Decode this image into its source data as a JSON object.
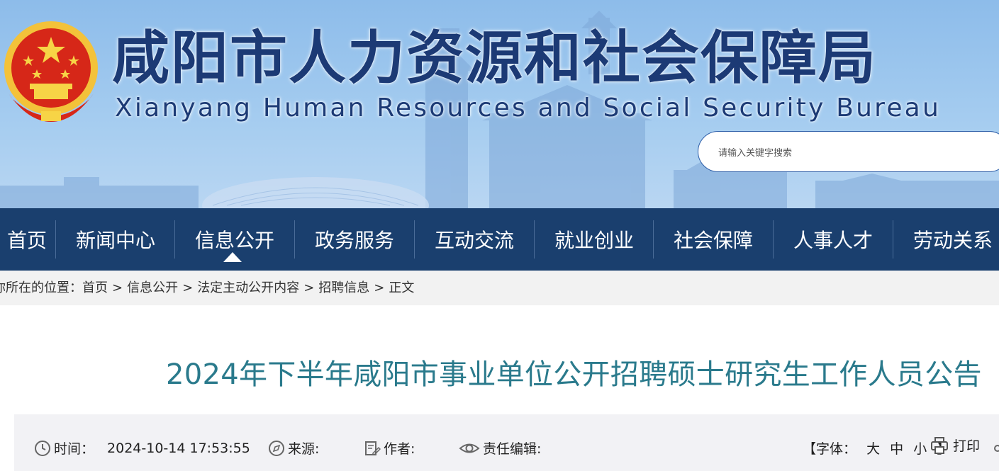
{
  "header": {
    "title": "咸阳市人力资源和社会保障局",
    "subtitle": "Xianyang Human Resources and Social Security Bureau",
    "search_placeholder": "请输入关键字搜索",
    "emblem_icon": "national-emblem-icon"
  },
  "nav": {
    "items": [
      {
        "label": "首页"
      },
      {
        "label": "新闻中心"
      },
      {
        "label": "信息公开",
        "active": true
      },
      {
        "label": "政务服务"
      },
      {
        "label": "互动交流"
      },
      {
        "label": "就业创业"
      },
      {
        "label": "社会保障"
      },
      {
        "label": "人事人才"
      },
      {
        "label": "劳动关系"
      }
    ]
  },
  "breadcrumb": {
    "prefix": "你所在的位置：",
    "items": [
      "首页",
      "信息公开",
      "法定主动公开内容",
      "招聘信息",
      "正文"
    ],
    "separator": ">"
  },
  "article": {
    "title": "2024年下半年咸阳市事业单位公开招聘硕士研究生工作人员公告",
    "time_label": "时间：",
    "time_value": "2024-10-14 17:53:55",
    "source_label": "来源:",
    "author_label": "作者:",
    "editor_label": "责任编辑:",
    "font_label": "【字体：",
    "font_sizes": [
      "大",
      "中",
      "小"
    ],
    "font_close": "】",
    "print_label": "打印"
  },
  "colors": {
    "nav_bg": "#1a3f6e",
    "title_color": "#1c3a75",
    "article_title_color": "#2a7a8c",
    "breadcrumb_bg": "#f2f2f2"
  }
}
